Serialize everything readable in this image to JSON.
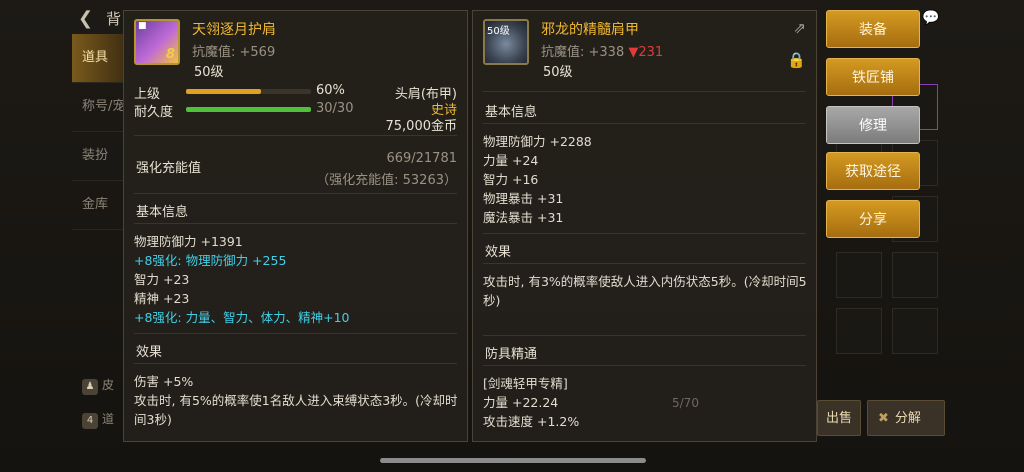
{
  "nav": {
    "title": "背",
    "items": [
      {
        "label": "道具"
      },
      {
        "label": "称号/宠"
      },
      {
        "label": "装扮"
      },
      {
        "label": "金库"
      }
    ],
    "extra1": "皮",
    "extra2": "道"
  },
  "itemA": {
    "name": "天翎逐月护肩",
    "badge_top": "8",
    "resist": "抗魔值: +569",
    "level": "50级",
    "upgrade_label": "上级",
    "upgrade_pct": "60%",
    "upgrade_fraction": 0.6,
    "durability_label": "耐久度",
    "durability": "30/30",
    "durability_fraction": 1.0,
    "slot_type": "头肩(布甲)",
    "rarity": "史诗",
    "price": "75,000金币",
    "charge_label": "强化充能值",
    "charge_value": "669/21781",
    "charge_sub": "（强化充能值: 53263）",
    "basic_title": "基本信息",
    "stats": [
      {
        "text": "物理防御力 +1391",
        "cyan": false
      },
      {
        "text": "+8强化: 物理防御力 +255",
        "cyan": true
      },
      {
        "text": "智力 +23",
        "cyan": false
      },
      {
        "text": "精神 +23",
        "cyan": false
      },
      {
        "text": "+8强化: 力量、智力、体力、精神+10",
        "cyan": true
      }
    ],
    "effect_title": "效果",
    "effects": [
      "伤害 +5%",
      "攻击时, 有5%的概率使1名敌人进入束缚状态3秒。(冷却时",
      "间3秒)"
    ]
  },
  "itemB": {
    "name": "邪龙的精髓肩甲",
    "icon_level": "50级",
    "resist": "抗魔值: +338",
    "resist_delta": "▼231",
    "level": "50级",
    "basic_title": "基本信息",
    "stats": [
      "物理防御力 +2288",
      "力量 +24",
      "智力 +16",
      "物理暴击 +31",
      "魔法暴击 +31"
    ],
    "effect_title": "效果",
    "effects": [
      "攻击时, 有3%的概率使敌人进入内伤状态5秒。(冷却时间5",
      "秒)"
    ],
    "mastery_title": "防具精通",
    "mastery": [
      "[剑魂轻甲专精]",
      "力量 +22.24",
      "攻击速度 +1.2%"
    ]
  },
  "actions": {
    "equip": "装备",
    "smith": "铁匠铺",
    "repair": "修理",
    "obtain": "获取途径",
    "share": "分享"
  },
  "bottom": {
    "sell": "出售",
    "decompose": "分解",
    "page": "5/70"
  },
  "colors": {
    "accent_gold": "#d49a22",
    "epic_orange": "#f0b830",
    "enhance_cyan": "#3fd0e8",
    "down_red": "#e03a3a"
  }
}
